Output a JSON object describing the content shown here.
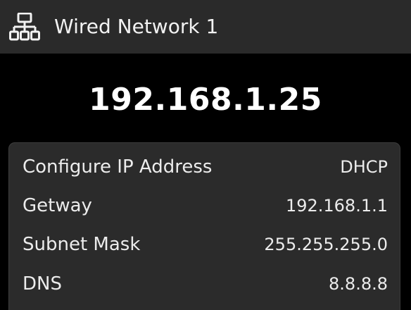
{
  "header": {
    "icon": "network-icon",
    "title": "Wired Network 1"
  },
  "ip_address": "192.168.1.25",
  "details": {
    "rows": [
      {
        "label": "Configure IP Address",
        "value": "DHCP"
      },
      {
        "label": "Getway",
        "value": "192.168.1.1"
      },
      {
        "label": "Subnet Mask",
        "value": "255.255.255.0"
      },
      {
        "label": "DNS",
        "value": "8.8.8.8"
      }
    ]
  },
  "colors": {
    "background": "#000000",
    "titlebar": "#2a2a2a",
    "panel": "#2b2b2b",
    "text": "#ececec"
  }
}
